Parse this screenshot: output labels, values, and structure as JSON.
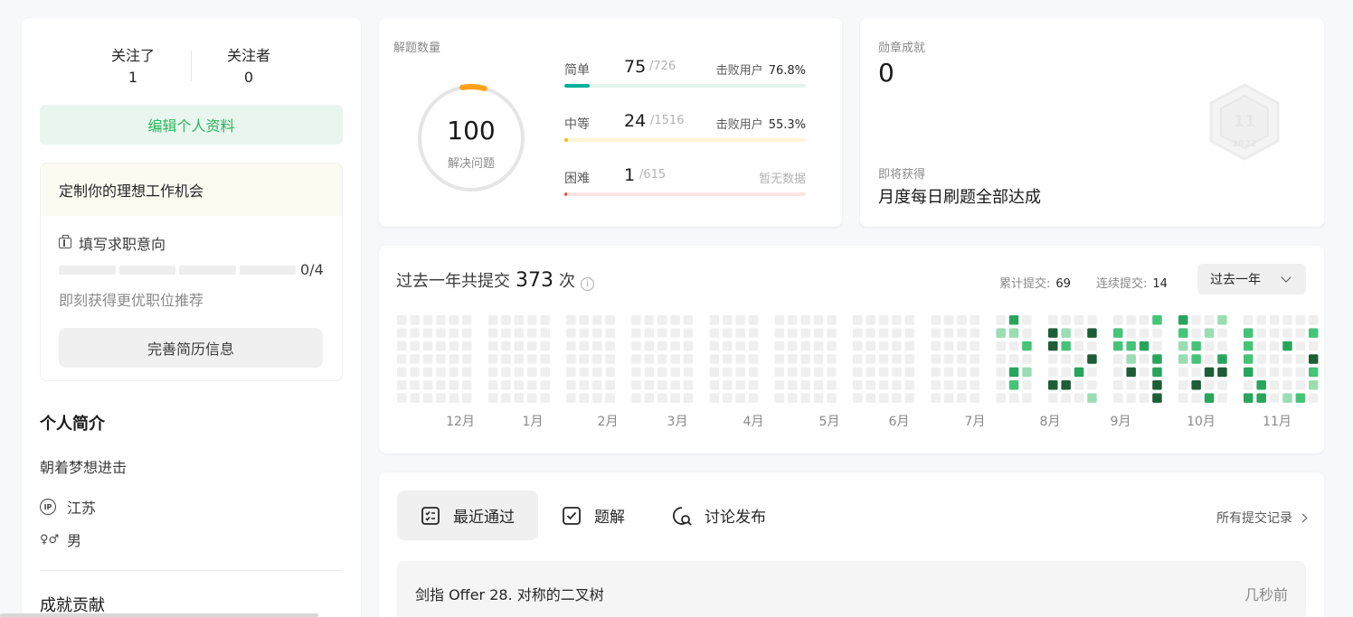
{
  "follow": {
    "following_label": "关注了",
    "following_count": "1",
    "followers_label": "关注者",
    "followers_count": "0"
  },
  "edit_profile_label": "编辑个人资料",
  "job": {
    "title": "定制你的理想工作机会",
    "fill_label": "填写求职意向",
    "progress_text": "0/4",
    "progress": 0,
    "hint": "即刻获得更优职位推荐",
    "button_label": "完善简历信息"
  },
  "bio": {
    "title": "个人简介",
    "text": "朝着梦想进击",
    "location": "江苏",
    "gender": "男",
    "contrib_title": "成就贡献"
  },
  "solve": {
    "label": "解题数量",
    "total": "100",
    "total_label": "解决问题",
    "rows": [
      {
        "name": "简单",
        "count": "75",
        "total": "/726",
        "beat_label": "击败用户",
        "beat": "76.8%",
        "color": "#00af9b",
        "track": "#e3f4ec",
        "ratio": 0.103
      },
      {
        "name": "中等",
        "count": "24",
        "total": "/1516",
        "beat_label": "击败用户",
        "beat": "55.3%",
        "color": "#ffb800",
        "track": "#fff4d6",
        "ratio": 0.016
      },
      {
        "name": "困难",
        "count": "1",
        "total": "/615",
        "nodata": "暂无数据",
        "color": "#ef4743",
        "track": "#fde4e3",
        "ratio": 0.002
      }
    ]
  },
  "badge": {
    "label": "勋章成就",
    "count": "0",
    "upcoming_label": "即将获得",
    "upcoming_name": "月度每日刷题全部达成",
    "icon": "badge-hexagon-icon"
  },
  "heatmap": {
    "prefix": "过去一年共提交",
    "count": "373",
    "suffix": "次",
    "total_label": "累计提交:",
    "total_value": "69",
    "streak_label": "连续提交:",
    "streak_value": "14",
    "range_label": "过去一年",
    "months": [
      "12月",
      "1月",
      "2月",
      "3月",
      "4月",
      "5月",
      "6月",
      "7月",
      "8月",
      "9月",
      "10月",
      "11月"
    ],
    "colors": [
      "#efefef",
      "#9bddb3",
      "#45c477",
      "#28a55c",
      "#1e5e37"
    ]
  },
  "recent": {
    "tabs": [
      {
        "label": "最近通过",
        "icon": "checklist-icon"
      },
      {
        "label": "题解",
        "icon": "checkbox-icon"
      },
      {
        "label": "讨论发布",
        "icon": "discussion-icon"
      }
    ],
    "all_label": "所有提交记录",
    "items": [
      {
        "title": "剑指 Offer 28. 对称的二叉树",
        "time": "几秒前"
      }
    ]
  }
}
